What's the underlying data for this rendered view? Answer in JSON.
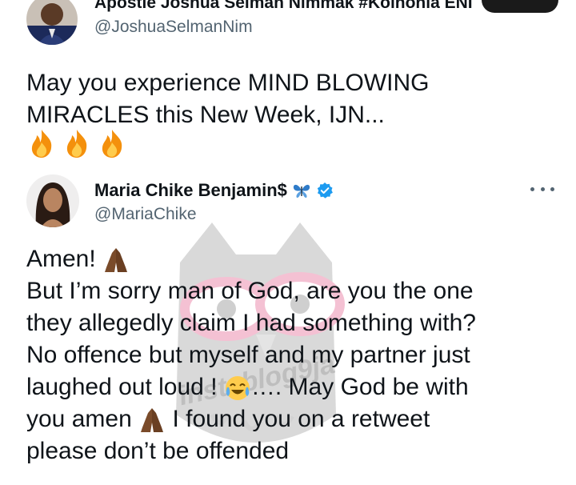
{
  "tweet1": {
    "display_name": "Apostle Joshua Selman Nimmak #Koinonia ENI",
    "handle": "@JoshuaSelmanNim",
    "lines": [
      "May you experience MIND BLOWING",
      "MIRACLES this New Week, IJN..."
    ],
    "emoji": [
      "fire-emoji",
      "fire-emoji",
      "fire-emoji"
    ]
  },
  "tweet2": {
    "display_name": "Maria Chike Benjamin$",
    "handle": "@MariaChike",
    "name_icons": [
      "butterfly-emoji",
      "verified-badge-icon"
    ],
    "more_icon": "more-options-icon",
    "lines": [
      "Amen!",
      "But I’m sorry man of God, are you the one",
      "they allegedly claim I had something with?",
      "No offence but myself and my partner just",
      "laughed out loud !",
      "…. May God be with",
      "you amen",
      "I found you on a retweet",
      "please don’t be offended"
    ]
  },
  "watermark": {
    "text": "instablog9ja"
  },
  "colors": {
    "text": "#0f1419",
    "secondary": "#536471",
    "verified": "#1d9bf0",
    "fire": "#f4900c",
    "hands": "#7a4b2a",
    "watermark_pink": "#e0457b"
  }
}
